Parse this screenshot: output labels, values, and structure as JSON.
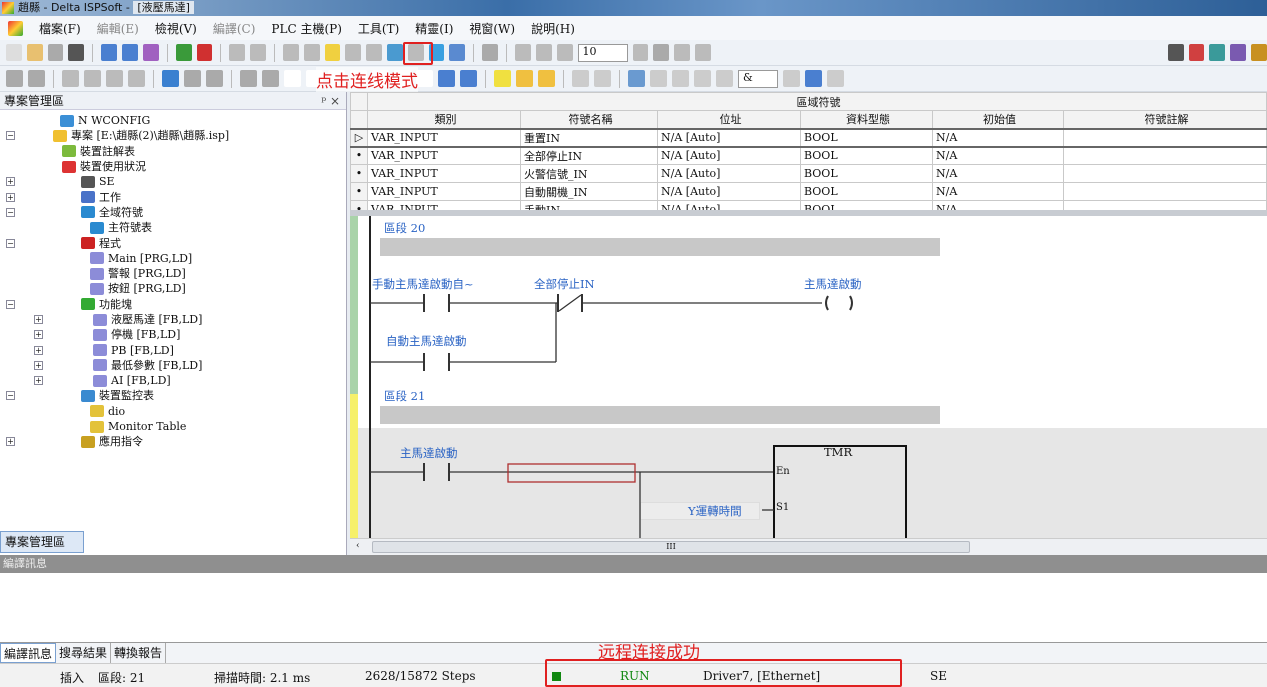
{
  "window": {
    "title_app": "趙縣 - Delta ISPSoft - ",
    "title_doc": "[液壓馬達]"
  },
  "menu": [
    "檔案(F)",
    "編輯(E)",
    "檢視(V)",
    "編譯(C)",
    "PLC 主機(P)",
    "工具(T)",
    "精靈(I)",
    "視窗(W)",
    "說明(H)"
  ],
  "menu_disabled": [
    1,
    3
  ],
  "toolbar": {
    "zoom_value": "10",
    "combo_value": "&"
  },
  "annotations": {
    "connect_mode": "点击连线模式",
    "remote_ok": "远程连接成功"
  },
  "project_panel": {
    "title": "專案管理區",
    "pin": "ᵖ ×",
    "tab": "專案管理區",
    "tree": [
      {
        "label": "N WCONFIG",
        "level": 1,
        "exp": "",
        "color": "#3b8fd6"
      },
      {
        "label": "專案 [E:\\趙縣(2)\\趙縣\\趙縣.isp]",
        "level": 0,
        "exp": "−",
        "color": "#f0c030"
      },
      {
        "label": "裝置註解表",
        "level": 2,
        "exp": "",
        "color": "#7cba3c"
      },
      {
        "label": "裝置使用狀況",
        "level": 2,
        "exp": "",
        "color": "#d33"
      },
      {
        "label": "SE",
        "level": 1,
        "exp": "+",
        "color": "#555"
      },
      {
        "label": "工作",
        "level": 1,
        "exp": "+",
        "color": "#4a72c8"
      },
      {
        "label": "全域符號",
        "level": 1,
        "exp": "−",
        "color": "#2a8ad0"
      },
      {
        "label": "主符號表",
        "level": 3,
        "exp": "",
        "color": "#2a8ad0"
      },
      {
        "label": "程式",
        "level": 1,
        "exp": "−",
        "color": "#c22"
      },
      {
        "label": "Main [PRG,LD]",
        "level": 3,
        "exp": "",
        "color": "#8c8cd8"
      },
      {
        "label": "警報 [PRG,LD]",
        "level": 3,
        "exp": "",
        "color": "#8c8cd8"
      },
      {
        "label": "按鈕 [PRG,LD]",
        "level": 3,
        "exp": "",
        "color": "#8c8cd8"
      },
      {
        "label": "功能塊",
        "level": 1,
        "exp": "−",
        "color": "#3a3"
      },
      {
        "label": "液壓馬達 [FB,LD]",
        "level": 3,
        "exp": "+",
        "color": "#8c8cd8"
      },
      {
        "label": "停機 [FB,LD]",
        "level": 3,
        "exp": "+",
        "color": "#8c8cd8"
      },
      {
        "label": "PB [FB,LD]",
        "level": 3,
        "exp": "+",
        "color": "#8c8cd8"
      },
      {
        "label": "最低參數 [FB,LD]",
        "level": 3,
        "exp": "+",
        "color": "#8c8cd8"
      },
      {
        "label": "AI [FB,LD]",
        "level": 3,
        "exp": "+",
        "color": "#8c8cd8"
      },
      {
        "label": "裝置監控表",
        "level": 1,
        "exp": "−",
        "color": "#3a8ad0"
      },
      {
        "label": "dio",
        "level": 3,
        "exp": "",
        "color": "#e3c23a"
      },
      {
        "label": "Monitor Table",
        "level": 3,
        "exp": "",
        "color": "#e3c23a"
      },
      {
        "label": "應用指令",
        "level": 1,
        "exp": "+",
        "color": "#c8a020"
      }
    ]
  },
  "symbols": {
    "title": "區域符號",
    "columns": [
      "類別",
      "符號名稱",
      "位址",
      "資料型態",
      "初始值",
      "符號註解"
    ],
    "rows": [
      [
        "VAR_INPUT",
        "重置IN",
        "N/A [Auto]",
        "BOOL",
        "N/A",
        ""
      ],
      [
        "VAR_INPUT",
        "全部停止IN",
        "N/A [Auto]",
        "BOOL",
        "N/A",
        ""
      ],
      [
        "VAR_INPUT",
        "火警信號_IN",
        "N/A [Auto]",
        "BOOL",
        "N/A",
        ""
      ],
      [
        "VAR_INPUT",
        "自動關機_IN",
        "N/A [Auto]",
        "BOOL",
        "N/A",
        ""
      ],
      [
        "VAR_INPUT",
        "手動IN",
        "N/A [Auto]",
        "BOOL",
        "N/A",
        ""
      ]
    ]
  },
  "ladder": {
    "net20": {
      "title": "區段 20",
      "c1": "手動主馬達啟動自~",
      "c2": "全部停止IN",
      "coil": "主馬達啟動",
      "c3": "自動主馬達啟動"
    },
    "net21": {
      "title": "區段 21",
      "c1": "主馬達啟動",
      "block": "TMR",
      "en": "En",
      "s1": "S1",
      "s1_var": "Y運轉時間"
    },
    "scroll": "III"
  },
  "messages": {
    "title": "編譯訊息",
    "tabs": [
      "編譯訊息",
      "搜尋結果",
      "轉換報告"
    ]
  },
  "status": {
    "mode": "插入",
    "network": "區段: 21",
    "scan": "掃描時間: 2.1 ms",
    "steps": "2628/15872 Steps",
    "run": "RUN",
    "driver": "Driver7, [Ethernet]",
    "plc": "SE",
    "run_color": "#118811"
  }
}
